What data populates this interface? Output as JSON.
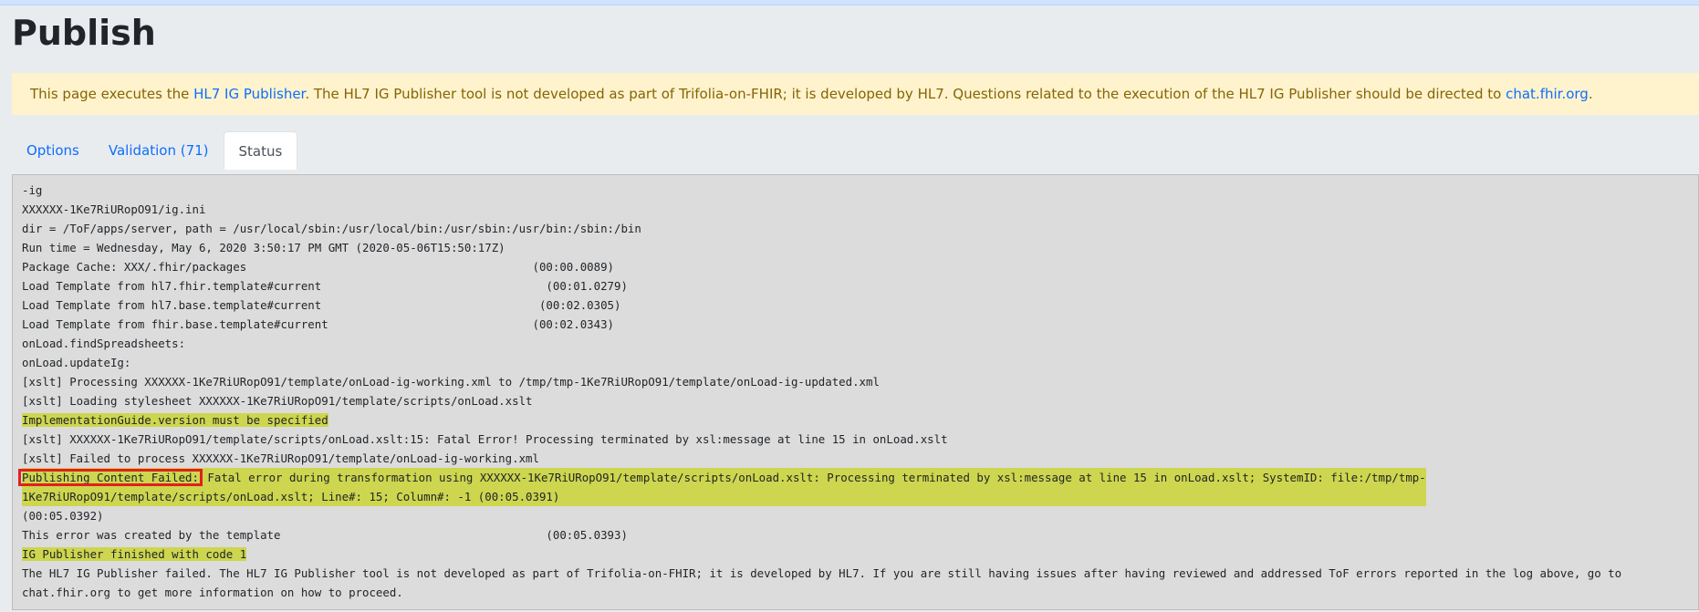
{
  "page": {
    "title": "Publish"
  },
  "alert": {
    "text_before": "This page executes the ",
    "link1": "HL7 IG Publisher",
    "text_middle": ". The HL7 IG Publisher tool is not developed as part of Trifolia-on-FHIR; it is developed by HL7. Questions related to the execution of the HL7 IG Publisher should be directed to ",
    "link2": "chat.fhir.org",
    "text_after": "."
  },
  "tabs": [
    {
      "label": "Options"
    },
    {
      "label": "Validation (71)"
    },
    {
      "label": "Status"
    }
  ],
  "log": {
    "lines": [
      "-ig",
      "XXXXXX-1Ke7RiURopO91/ig.ini",
      "dir = /ToF/apps/server, path = /usr/local/sbin:/usr/local/bin:/usr/sbin:/usr/bin:/sbin:/bin",
      "Run time = Wednesday, May 6, 2020 3:50:17 PM GMT (2020-05-06T15:50:17Z)",
      "Package Cache: XXX/.fhir/packages                                          (00:00.0089)",
      "Load Template from hl7.fhir.template#current                                 (00:01.0279)",
      "Load Template from hl7.base.template#current                                (00:02.0305)",
      "Load Template from fhir.base.template#current                              (00:02.0343)",
      "onLoad.findSpreadsheets:",
      "onLoad.updateIg:",
      "[xslt] Processing XXXXXX-1Ke7RiURopO91/template/onLoad-ig-working.xml to /tmp/tmp-1Ke7RiURopO91/template/onLoad-ig-updated.xml",
      "[xslt] Loading stylesheet XXXXXX-1Ke7RiURopO91/template/scripts/onLoad.xslt"
    ],
    "highlight1": "ImplementationGuide.version must be specified",
    "line_fatal": "[xslt] XXXXXX-1Ke7RiURopO91/template/scripts/onLoad.xslt:15: Fatal Error! Processing terminated by xsl:message at line 15 in onLoad.xslt",
    "line_failed": "[xslt] Failed to process XXXXXX-1Ke7RiURopO91/template/onLoad-ig-working.xml",
    "publishing_label": "Publishing Content Failed:",
    "publishing_rest1": " Fatal error during transformation using XXXXXX-1Ke7RiURopO91/template/scripts/onLoad.xslt: Processing terminated by xsl:message at line 15 in onLoad.xslt; SystemID: file:/tmp/tmp-",
    "publishing_rest2": "1Ke7RiURopO91/template/scripts/onLoad.xslt; Line#: 15; Column#: -1 (00:05.0391)",
    "line_time": "(00:05.0392)",
    "line_template": "This error was created by the template                                       (00:05.0393)",
    "highlight2": "IG Publisher finished with code 1",
    "final1": "The HL7 IG Publisher failed. The HL7 IG Publisher tool is not developed as part of Trifolia-on-FHIR; it is developed by HL7. If you are still having issues after having reviewed and addressed ToF errors reported in the log above, go to",
    "final2": "chat.fhir.org to get more information on how to proceed."
  }
}
